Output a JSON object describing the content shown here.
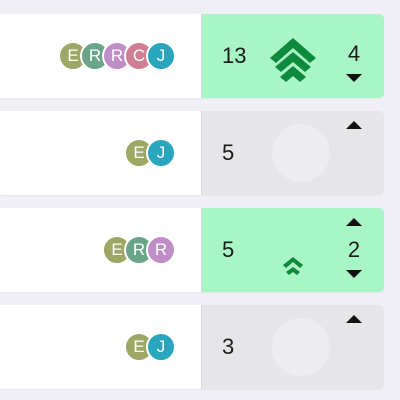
{
  "colors": {
    "highlight_bg": "#a8f5c6",
    "neutral_bg": "#e6e6e9",
    "chevron": "#0d8a3c",
    "avatar_E": "#9ea765",
    "avatar_R_green": "#6aa58a",
    "avatar_R_pink": "#c08ec7",
    "avatar_C": "#cf7f95",
    "avatar_J": "#29a6bd"
  },
  "cards": [
    {
      "avatars": [
        {
          "letter": "E",
          "color": "#9ea765"
        },
        {
          "letter": "R",
          "color": "#6aa58a"
        },
        {
          "letter": "R",
          "color": "#c08ec7"
        },
        {
          "letter": "C",
          "color": "#cf7f95"
        },
        {
          "letter": "J",
          "color": "#29a6bd"
        }
      ],
      "score": "13",
      "votes": "4",
      "highlighted": true,
      "rank_icon": "triple-chevron-up-icon",
      "show_up_arrow": false,
      "show_down_arrow": true
    },
    {
      "avatars": [
        {
          "letter": "E",
          "color": "#9ea765"
        },
        {
          "letter": "J",
          "color": "#29a6bd"
        }
      ],
      "score": "5",
      "votes": "",
      "highlighted": false,
      "rank_icon": "",
      "show_up_arrow": true,
      "show_down_arrow": false
    },
    {
      "avatars": [
        {
          "letter": "E",
          "color": "#9ea765"
        },
        {
          "letter": "R",
          "color": "#6aa58a"
        },
        {
          "letter": "R",
          "color": "#c08ec7"
        }
      ],
      "score": "5",
      "votes": "2",
      "highlighted": true,
      "rank_icon": "double-chevron-up-icon",
      "show_up_arrow": true,
      "show_down_arrow": true
    },
    {
      "avatars": [
        {
          "letter": "E",
          "color": "#9ea765"
        },
        {
          "letter": "J",
          "color": "#29a6bd"
        }
      ],
      "score": "3",
      "votes": "",
      "highlighted": false,
      "rank_icon": "",
      "show_up_arrow": true,
      "show_down_arrow": false
    }
  ]
}
